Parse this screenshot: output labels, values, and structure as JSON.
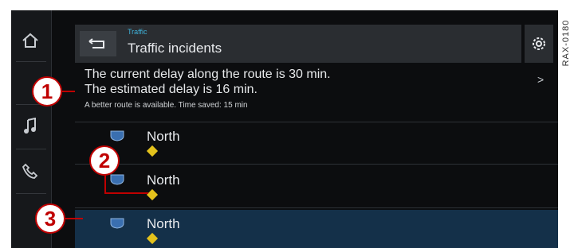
{
  "side_label": "RAX-0180",
  "sidebar": {
    "items": [
      {
        "icon": "home-icon"
      },
      {
        "icon": "music-note-icon"
      },
      {
        "icon": "phone-icon"
      }
    ]
  },
  "header": {
    "breadcrumb": "Traffic",
    "title": "Traffic incidents",
    "back_icon": "back-arrow-icon",
    "settings_icon": "gear-icon"
  },
  "summary": {
    "line1": "The current delay along the route is 30 min.",
    "line2": "The estimated delay is 16 min.",
    "line3": "A better route is available. Time saved: 15 min",
    "chevron": ">"
  },
  "incidents": [
    {
      "label": "North",
      "selected": false
    },
    {
      "label": "North",
      "selected": false
    },
    {
      "label": "North",
      "selected": true
    }
  ],
  "callouts": [
    "1",
    "2",
    "3"
  ],
  "colors": {
    "accent": "#3fb1d8",
    "selected_row": "#143049",
    "warning_diamond": "#e4c21c",
    "callout_red": "#c00000"
  }
}
